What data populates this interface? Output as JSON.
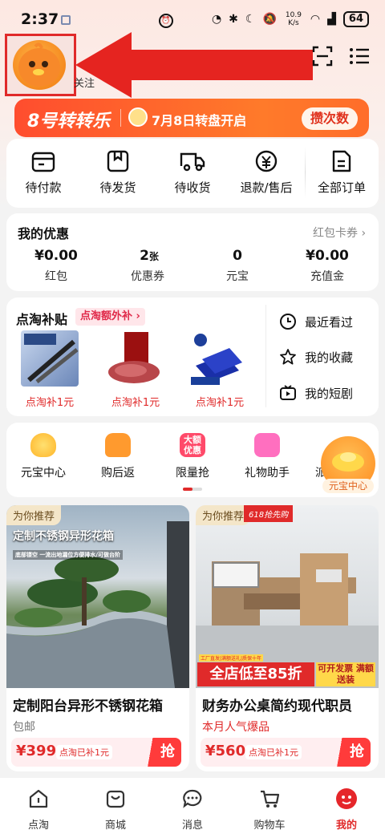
{
  "status_bar": {
    "time": "2:37",
    "network_speed": "10.9 K/s",
    "battery": "64"
  },
  "header": {
    "follow_text": "关注",
    "scan_icon": "scan-icon",
    "menu_icon": "menu-icon"
  },
  "banner": {
    "title": "8号转转乐",
    "subtitle": "7月8日转盘开启",
    "button": "攒次数"
  },
  "orders": [
    {
      "label": "待付款",
      "icon": "wallet-icon"
    },
    {
      "label": "待发货",
      "icon": "package-icon"
    },
    {
      "label": "待收货",
      "icon": "truck-icon"
    },
    {
      "label": "退款/售后",
      "icon": "refund-icon"
    },
    {
      "label": "全部订单",
      "icon": "document-icon"
    }
  ],
  "coupons": {
    "title": "我的优惠",
    "link": "红包卡券 ›",
    "items": [
      {
        "value": "¥0.00",
        "label": "红包"
      },
      {
        "value": "2",
        "unit": "张",
        "label": "优惠券"
      },
      {
        "value": "0",
        "label": "元宝"
      },
      {
        "value": "¥0.00",
        "label": "充值金"
      }
    ]
  },
  "subsidy": {
    "title": "点淘补贴",
    "tag": "点淘额外补 ›",
    "products": [
      {
        "price": "点淘补1元"
      },
      {
        "price": "点淘补1元"
      },
      {
        "price": "点淘补1元"
      }
    ],
    "side": [
      {
        "label": "最近看过",
        "icon": "clock-icon"
      },
      {
        "label": "我的收藏",
        "icon": "star-icon"
      },
      {
        "label": "我的短剧",
        "icon": "tv-icon"
      }
    ]
  },
  "tools": [
    {
      "label": "元宝中心",
      "color": "#ffc93a"
    },
    {
      "label": "购后返",
      "color": "#ff9a2e"
    },
    {
      "label": "限量抢",
      "color": "#ff4a6a",
      "badge": "大额优惠"
    },
    {
      "label": "礼物助手",
      "color": "#ff6fbf"
    },
    {
      "label": "派"
    }
  ],
  "float_badge": "元宝中心",
  "feed": [
    {
      "tag": "为你推荐",
      "img_text": "定制不锈钢异形花箱",
      "img_subtext": "底部镂空 一流出地漏位方便排水/可做台阶",
      "title": "定制阳台异形不锈钢花箱",
      "sub": "包邮",
      "sub_color": "#777",
      "price": "¥399",
      "subsidy": "点淘已补1元",
      "grab": "抢"
    },
    {
      "tag": "为你推荐",
      "img_badge": "618抢先购",
      "img_text": "全店低至85折",
      "img_subtext": "可开发票 满额送装",
      "img_factory": "工厂直发|满额送礼|质保十年",
      "title": "财务办公桌简约现代职员",
      "sub": "本月人气爆品",
      "sub_color": "#e02a2a",
      "price": "¥560",
      "subsidy": "点淘已补1元",
      "grab": "抢"
    }
  ],
  "tabbar": [
    {
      "label": "点淘",
      "icon": "home-icon"
    },
    {
      "label": "商城",
      "icon": "mall-icon"
    },
    {
      "label": "消息",
      "icon": "message-icon"
    },
    {
      "label": "购物车",
      "icon": "cart-icon"
    },
    {
      "label": "我的",
      "icon": "profile-icon",
      "active": true
    }
  ]
}
